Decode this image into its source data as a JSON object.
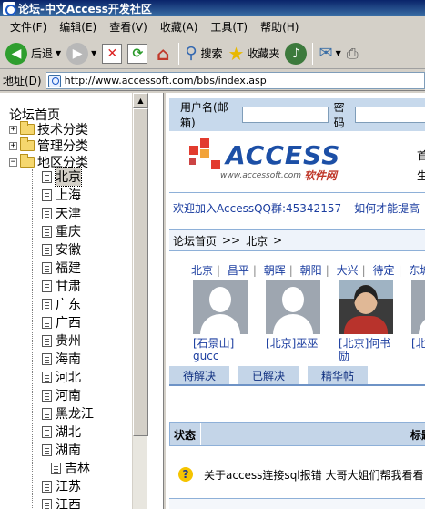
{
  "window": {
    "title": "论坛-中文Access开发社区"
  },
  "menu": [
    "文件(F)",
    "编辑(E)",
    "查看(V)",
    "收藏(A)",
    "工具(T)",
    "帮助(H)"
  ],
  "toolbar": {
    "back": "后退",
    "search": "搜索",
    "favorites": "收藏夹"
  },
  "address": {
    "label": "地址(D)",
    "url": "http://www.accessoft.com/bbs/index.asp"
  },
  "tree": {
    "root": "论坛首页",
    "categories": [
      {
        "label": "技术分类",
        "expanded": false
      },
      {
        "label": "管理分类",
        "expanded": false
      },
      {
        "label": "地区分类",
        "expanded": true
      }
    ],
    "regions": [
      "北京",
      "上海",
      "天津",
      "重庆",
      "安徽",
      "福建",
      "甘肃",
      "广东",
      "广西",
      "贵州",
      "海南",
      "河北",
      "河南",
      "黑龙江",
      "湖北",
      "湖南",
      "吉林",
      "江苏",
      "江西"
    ],
    "selected": "北京"
  },
  "login": {
    "username_label": "用户名(邮箱)",
    "password_label": "密码"
  },
  "logo": {
    "brand": "ACCESS",
    "sub": "www.accessoft.com",
    "cn": "软件网"
  },
  "side_links": [
    "首",
    "生"
  ],
  "welcome": {
    "text": "欢迎加入AccessQQ群:45342157",
    "promo": "如何才能提高"
  },
  "breadcrumb": [
    "论坛首页",
    ">",
    ">",
    "北京",
    ">"
  ],
  "regions_row": [
    "北京",
    "昌平",
    "朝晖",
    "朝阳",
    "大兴",
    "待定",
    "东城"
  ],
  "moderators": [
    {
      "line1": "[石景山]",
      "line2": "gucc",
      "avatar": "silhouette"
    },
    {
      "line1": "[北京]巫巫",
      "line2": "",
      "avatar": "silhouette"
    },
    {
      "line1": "[北京]何书",
      "line2": "励",
      "avatar": "photo"
    },
    {
      "line1": "[北",
      "line2": "",
      "avatar": "silhouette"
    }
  ],
  "tabs": [
    "待解决",
    "已解决",
    "精华帖"
  ],
  "table": {
    "headers": {
      "status": "状态",
      "title": "标题"
    },
    "rows": [
      {
        "title": "关于access连接sql报错 大哥大姐们帮我看看"
      }
    ]
  },
  "colors": {
    "brand": "#1c4fa6",
    "link": "#1c3ea0",
    "panel": "#c4d5e8"
  }
}
